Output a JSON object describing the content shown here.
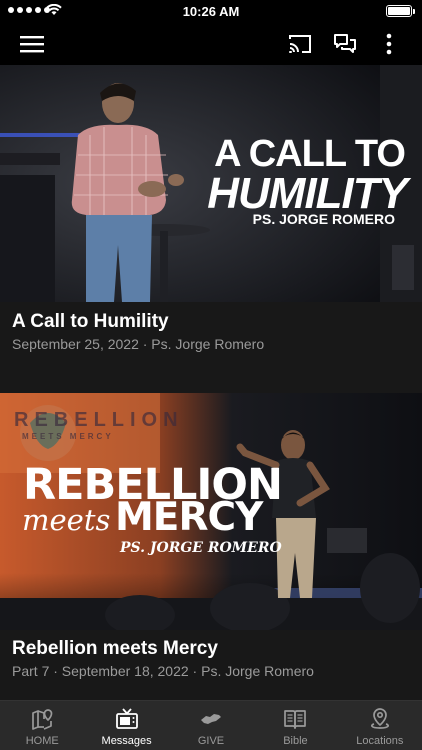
{
  "status_bar": {
    "time": "10:26 AM"
  },
  "app_bar": {
    "menu_icon": "hamburger-menu-icon",
    "cast_icon": "cast-icon",
    "chat_icon": "chat-bubbles-icon",
    "more_icon": "more-vertical-icon"
  },
  "sermons": [
    {
      "art_line1": "A CALL TO",
      "art_line2": "HUMILITY",
      "art_speaker": "PS. JORGE ROMERO",
      "title": "A Call to Humility",
      "meta": "September 25, 2022 · Ps. Jorge Romero"
    },
    {
      "art_backdrop": "REBELLION",
      "art_backdrop_sub": "MEETS MERCY",
      "art_line1": "REBELLION",
      "art_line2a": "meets",
      "art_line2b": "MERCY",
      "art_speaker": "PS. JORGE ROMERO",
      "title": "Rebellion meets Mercy",
      "meta": "Part 7 · September 18, 2022 · Ps. Jorge Romero"
    }
  ],
  "tabs": [
    {
      "label": "HOME",
      "icon": "map-pin-icon",
      "active": false
    },
    {
      "label": "Messages",
      "icon": "tv-icon",
      "active": true
    },
    {
      "label": "GIVE",
      "icon": "handshake-icon",
      "active": false
    },
    {
      "label": "Bible",
      "icon": "open-book-icon",
      "active": false
    },
    {
      "label": "Locations",
      "icon": "location-pin-icon",
      "active": false
    }
  ],
  "colors": {
    "background": "#181818",
    "bar": "#000000",
    "tab_bar": "#2a2a2a",
    "muted_text": "#9a9a9a",
    "accent_orange": "#d9652f"
  }
}
